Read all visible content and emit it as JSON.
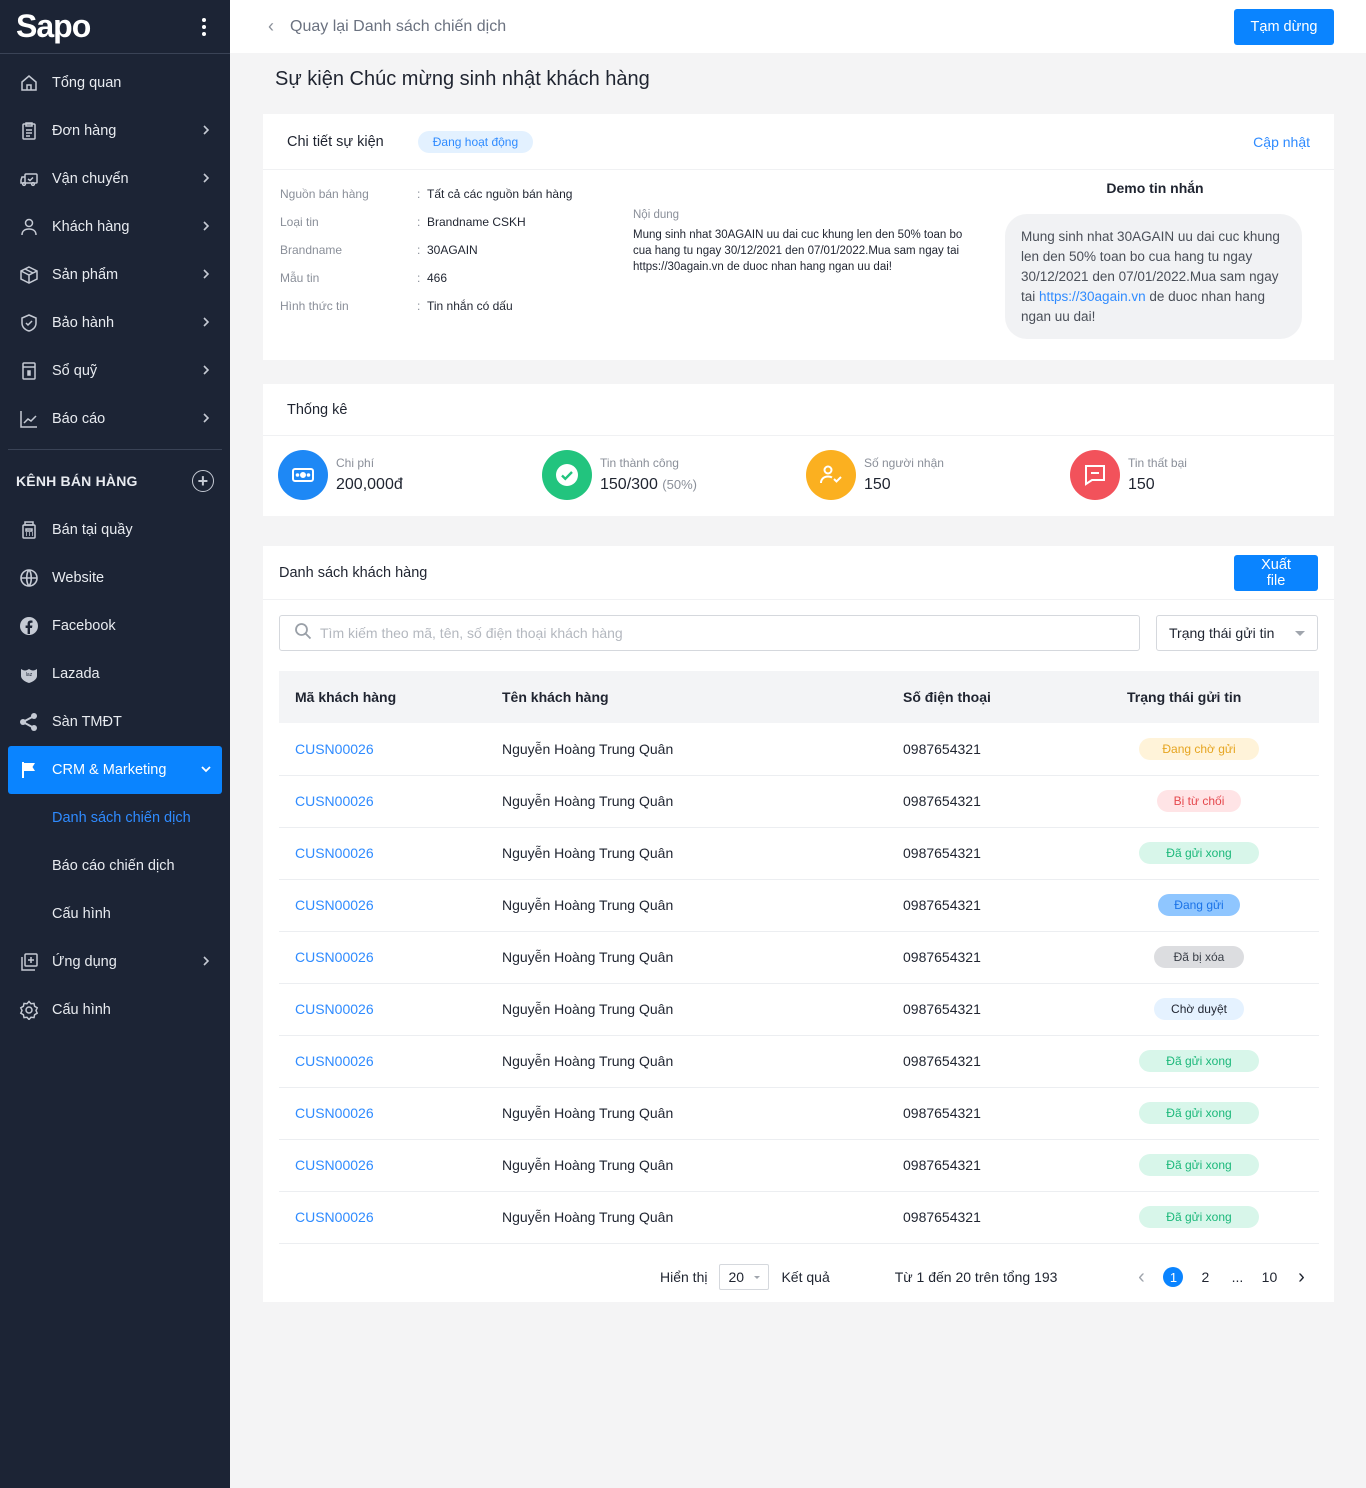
{
  "sidebar": {
    "logo": "Sapo",
    "items": [
      {
        "label": "Tổng quan",
        "icon": "home-icon",
        "chevron": false
      },
      {
        "label": "Đơn hàng",
        "icon": "clipboard-icon",
        "chevron": true
      },
      {
        "label": "Vận chuyển",
        "icon": "truck-icon",
        "chevron": true
      },
      {
        "label": "Khách hàng",
        "icon": "user-icon",
        "chevron": true
      },
      {
        "label": "Sản phẩm",
        "icon": "box-icon",
        "chevron": true
      },
      {
        "label": "Bảo hành",
        "icon": "shield-check-icon",
        "chevron": true
      },
      {
        "label": "Sổ quỹ",
        "icon": "ledger-icon",
        "chevron": true
      },
      {
        "label": "Báo cáo",
        "icon": "chart-line-icon",
        "chevron": true
      }
    ],
    "channels_heading": "KÊNH BÁN HÀNG",
    "channels": [
      {
        "label": "Bán tại quầy",
        "icon": "cash-register-icon"
      },
      {
        "label": "Website",
        "icon": "globe-icon"
      },
      {
        "label": "Facebook",
        "icon": "facebook-icon"
      },
      {
        "label": "Lazada",
        "icon": "lazada-icon"
      },
      {
        "label": "Sàn TMĐT",
        "icon": "share-icon"
      }
    ],
    "crm": {
      "label": "CRM & Marketing",
      "icon": "flag-icon"
    },
    "crm_sub": [
      "Danh sách chiến dịch",
      "Báo cáo chiến dịch",
      "Cấu hình"
    ],
    "bottom": [
      {
        "label": "Ứng dụng",
        "icon": "app-add-icon",
        "chevron": true
      },
      {
        "label": "Cấu hình",
        "icon": "gear-icon",
        "chevron": false
      }
    ]
  },
  "topbar": {
    "back_label": "Quay lại Danh sách chiến dịch",
    "pause_label": "Tạm dừng"
  },
  "page_title": "Sự kiện Chúc mừng sinh nhật khách hàng",
  "detail": {
    "title": "Chi tiết sự kiện",
    "status": "Đang hoạt động",
    "update_label": "Cập nhật",
    "fields": [
      {
        "key": "Nguồn bán hàng",
        "value": "Tất cả các nguồn bán hàng"
      },
      {
        "key": "Loại tin",
        "value": "Brandname CSKH"
      },
      {
        "key": "Brandname",
        "value": "30AGAIN"
      },
      {
        "key": "Mẫu tin",
        "value": "466"
      },
      {
        "key": "Hình thức tin",
        "value": "Tin nhắn có dấu"
      }
    ],
    "content_label": "Nội dung",
    "content": "Mung sinh nhat 30AGAIN uu dai cuc khung len den 50% toan bo cua hang tu ngay 30/12/2021 den 07/01/2022.Mua sam ngay tai https://30again.vn de duoc nhan hang ngan uu dai!",
    "demo_title": "Demo tin nhắn",
    "demo_before": "Mung sinh nhat 30AGAIN uu dai cuc khung len den 50% toan bo cua hang tu ngay 30/12/2021 den 07/01/2022.Mua sam ngay tai ",
    "demo_link": "https://30again.vn",
    "demo_after": " de duoc nhan hang ngan uu dai!"
  },
  "stats": {
    "title": "Thống kê",
    "items": [
      {
        "label": "Chi phí",
        "value": "200,000đ",
        "extra": "",
        "icon": "money-icon",
        "color": "#1e88f5"
      },
      {
        "label": "Tin thành công",
        "value": "150/300",
        "extra": "(50%)",
        "icon": "check-circle-icon",
        "color": "#22c47e"
      },
      {
        "label": "Số người nhận",
        "value": "150",
        "extra": "",
        "icon": "user-check-icon",
        "color": "#fbb020"
      },
      {
        "label": "Tin thất bại",
        "value": "150",
        "extra": "",
        "icon": "message-icon",
        "color": "#f2525b"
      }
    ]
  },
  "customers": {
    "title": "Danh sách khách hàng",
    "export_label": "Xuất file",
    "search_placeholder": "Tìm kiếm theo mã, tên, số điện thoại khách hàng",
    "status_filter": "Trạng thái gửi tin",
    "columns": [
      "Mã khách hàng",
      "Tên khách hàng",
      "Số điện thoại",
      "Trạng thái gửi tin"
    ],
    "rows": [
      {
        "code": "CUSN00026",
        "name": "Nguyễn Hoàng Trung Quân",
        "phone": "0987654321",
        "status": "Đang chờ gửi",
        "kind": "waiting"
      },
      {
        "code": "CUSN00026",
        "name": "Nguyễn Hoàng Trung Quân",
        "phone": "0987654321",
        "status": "Bị từ chối",
        "kind": "rejected"
      },
      {
        "code": "CUSN00026",
        "name": "Nguyễn Hoàng Trung Quân",
        "phone": "0987654321",
        "status": "Đã gửi xong",
        "kind": "sent"
      },
      {
        "code": "CUSN00026",
        "name": "Nguyễn Hoàng Trung Quân",
        "phone": "0987654321",
        "status": "Đang gửi",
        "kind": "sending"
      },
      {
        "code": "CUSN00026",
        "name": "Nguyễn Hoàng Trung Quân",
        "phone": "0987654321",
        "status": "Đã bị xóa",
        "kind": "deleted"
      },
      {
        "code": "CUSN00026",
        "name": "Nguyễn Hoàng Trung Quân",
        "phone": "0987654321",
        "status": "Chờ duyệt",
        "kind": "pending"
      },
      {
        "code": "CUSN00026",
        "name": "Nguyễn Hoàng Trung Quân",
        "phone": "0987654321",
        "status": "Đã gửi xong",
        "kind": "sent"
      },
      {
        "code": "CUSN00026",
        "name": "Nguyễn Hoàng Trung Quân",
        "phone": "0987654321",
        "status": "Đã gửi xong",
        "kind": "sent"
      },
      {
        "code": "CUSN00026",
        "name": "Nguyễn Hoàng Trung Quân",
        "phone": "0987654321",
        "status": "Đã gửi xong",
        "kind": "sent"
      },
      {
        "code": "CUSN00026",
        "name": "Nguyễn Hoàng Trung Quân",
        "phone": "0987654321",
        "status": "Đã gửi xong",
        "kind": "sent"
      }
    ],
    "pagination": {
      "show_label": "Hiển thị",
      "page_size": "20",
      "result_label": "Kết quả",
      "range_text": "Từ 1 đến 20 trên tổng 193",
      "pages": [
        "1",
        "2",
        "...",
        "10"
      ],
      "current": "1"
    }
  }
}
